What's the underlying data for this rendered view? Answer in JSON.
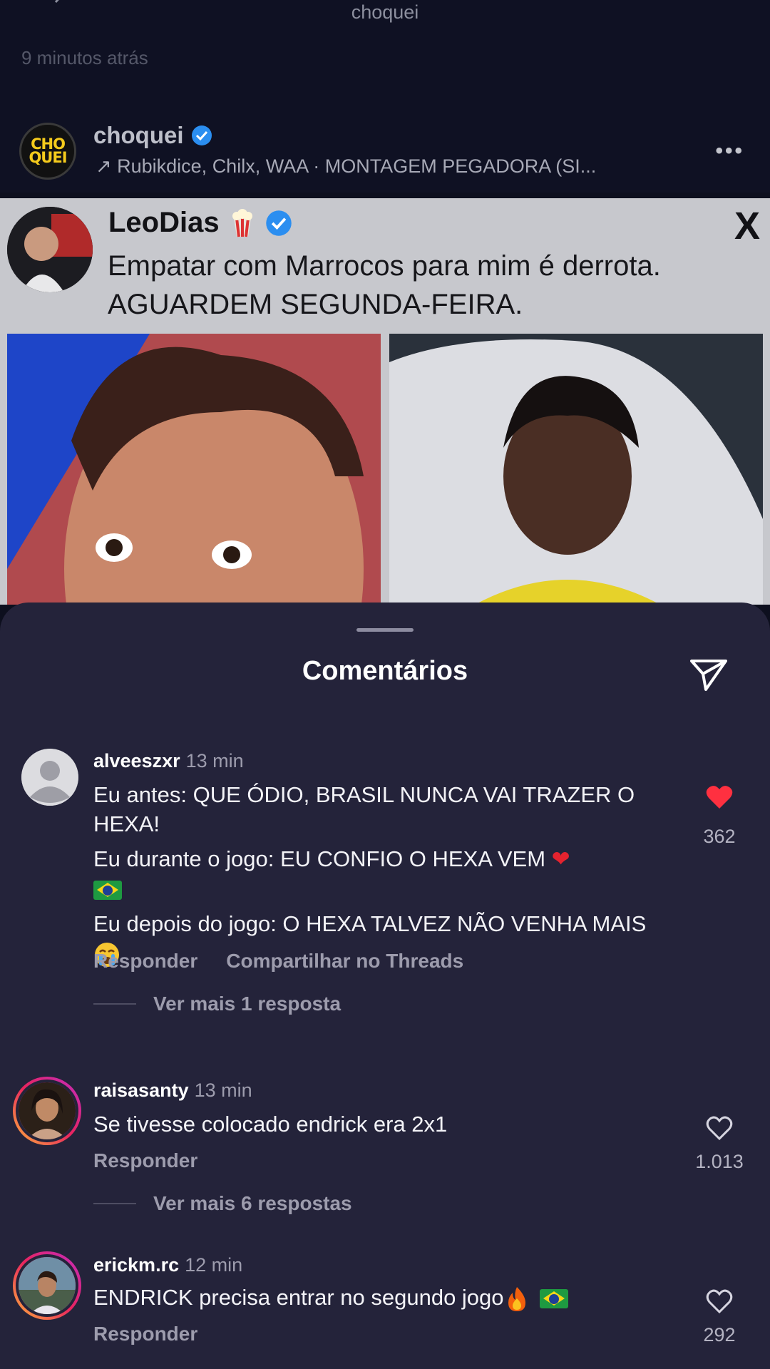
{
  "header": {
    "title": "choquei",
    "time_ago": "9 minutos atrás"
  },
  "post": {
    "username": "choquei",
    "avatar_text": "CHO QUEI",
    "music": "↗ Rubikdice, Chilx, WAA · MONTAGEM PEGADORA (SI...",
    "more": "•••"
  },
  "tweet": {
    "author": "LeoDias",
    "text_line1": "Empatar com Marrocos para mim é derrota.",
    "text_line2": "AGUARDEM SEGUNDA-FEIRA.",
    "platform_icon": "X"
  },
  "comments_sheet": {
    "title": "Comentários",
    "accent_like": "#ff3040"
  },
  "comments": [
    {
      "username": "alveeszxr",
      "time": "13 min",
      "lines": [
        "Eu antes: QUE ÓDIO, BRASIL NUNCA VAI TRAZER O HEXA!",
        "Eu durante o jogo: EU CONFIO O HEXA VEM",
        "Eu depois do jogo: O HEXA TALVEZ NÃO VENHA MAIS"
      ],
      "reply": "Responder",
      "share": "Compartilhar no Threads",
      "more_replies": "Ver mais 1 resposta",
      "likes": "362",
      "liked": true
    },
    {
      "username": "raisasanty",
      "time": "13 min",
      "text": "Se tivesse colocado endrick era 2x1",
      "reply": "Responder",
      "more_replies": "Ver mais 6 respostas",
      "likes": "1.013",
      "liked": false
    },
    {
      "username": "erickm.rc",
      "time": "12 min",
      "text": "ENDRICK precisa entrar no segundo jogo",
      "reply": "Responder",
      "likes": "292",
      "liked": false
    }
  ]
}
